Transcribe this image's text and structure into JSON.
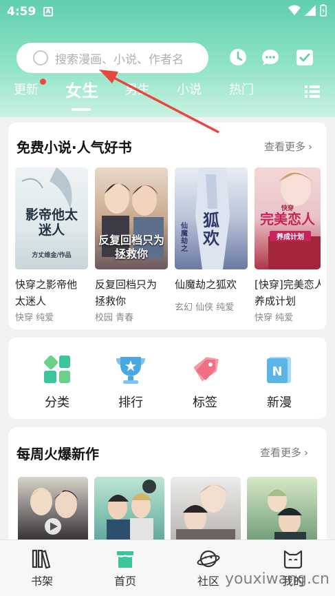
{
  "status_bar": {
    "time": "4:59",
    "app_badge": "A"
  },
  "search": {
    "placeholder": "搜索漫画、小说、作者名"
  },
  "header_icons": [
    "clock-icon",
    "message-icon",
    "checkin-icon"
  ],
  "tabs": [
    {
      "label": "更新",
      "active": false,
      "has_dot": true
    },
    {
      "label": "女生",
      "active": true
    },
    {
      "label": "男生",
      "active": false
    },
    {
      "label": "小说",
      "active": false
    },
    {
      "label": "热门",
      "active": false
    }
  ],
  "free_novels": {
    "title": "免费小说·人气好书",
    "more": "查看更多",
    "books": [
      {
        "name_line1": "快穿之影帝他",
        "name_line2": "太迷人",
        "tags": "快穿 纯爱",
        "cover_text": "影帝他太迷人",
        "cover_sub": "方丈维金/作品"
      },
      {
        "name_line1": "反复回档只为",
        "name_line2": "拯救你",
        "tags": "校园 青春",
        "cover_text": "反复回档只为拯救你"
      },
      {
        "name_line1": "仙魔劫之狐欢",
        "name_line2": "",
        "tags": "玄幻 仙侠 纯爱",
        "cover_text": "狐欢",
        "cover_sub": "仙魔劫之"
      },
      {
        "name_line1": "[快穿]完美恋人",
        "name_line2": "养成计划",
        "tags": "快穿 纯爱",
        "cover_text": "完美恋人",
        "cover_sub": "养成计划",
        "cover_badge": "快穿"
      }
    ]
  },
  "categories": [
    {
      "label": "分类",
      "icon": "category-grid-icon"
    },
    {
      "label": "排行",
      "icon": "ranking-trophy-icon"
    },
    {
      "label": "标签",
      "icon": "tag-icon"
    },
    {
      "label": "新漫",
      "icon": "new-comic-icon"
    }
  ],
  "weekly": {
    "title": "每周火爆新作",
    "more": "查看更多"
  },
  "bottom_nav": [
    {
      "label": "书架",
      "icon": "bookshelf-icon",
      "active": false
    },
    {
      "label": "首页",
      "icon": "home-icon",
      "active": true
    },
    {
      "label": "社区",
      "icon": "community-planet-icon",
      "active": false
    },
    {
      "label": "我的",
      "icon": "profile-cat-icon",
      "active": false
    }
  ],
  "watermark": "youxiwang.cn",
  "colors": {
    "accent": "#3cc59b",
    "header_top": "#5fcfae",
    "red_dot": "#f04a3c",
    "arrow": "#e8453c"
  }
}
